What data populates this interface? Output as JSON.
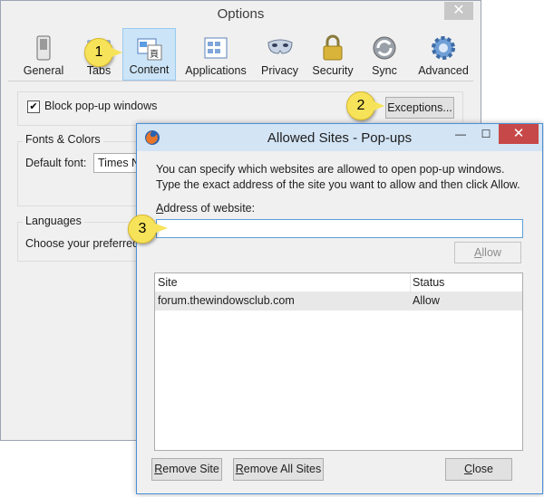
{
  "options_window": {
    "title": "Options",
    "close_glyph": "✕",
    "toolbar": [
      {
        "label": "General",
        "icon": "switch-icon"
      },
      {
        "label": "Tabs",
        "icon": "tabs-icon"
      },
      {
        "label": "Content",
        "icon": "content-icon",
        "selected": true
      },
      {
        "label": "Applications",
        "icon": "applications-icon"
      },
      {
        "label": "Privacy",
        "icon": "mask-icon"
      },
      {
        "label": "Security",
        "icon": "lock-icon"
      },
      {
        "label": "Sync",
        "icon": "sync-icon"
      },
      {
        "label": "Advanced",
        "icon": "gear-icon"
      }
    ],
    "block_popups_label": "Block pop-up windows",
    "block_popups_checked": true,
    "exceptions_label": "Exceptions...",
    "fonts_colors_group": "Fonts & Colors",
    "default_font_label": "Default font:",
    "default_font_value": "Times N",
    "languages_group": "Languages",
    "choose_preferred_label": "Choose your preferred"
  },
  "callouts": [
    "1",
    "2",
    "3"
  ],
  "dialog": {
    "title": "Allowed Sites - Pop-ups",
    "minimize_glyph": "—",
    "maximize_glyph": "☐",
    "close_glyph": "✕",
    "description": "You can specify which websites are allowed to open pop-up windows. Type the exact address of the site you want to allow and then click Allow.",
    "address_label": "Address of website:",
    "address_value": "",
    "allow_label": "Allow",
    "columns": [
      "Site",
      "Status"
    ],
    "rows": [
      {
        "site": "forum.thewindowsclub.com",
        "status": "Allow"
      }
    ],
    "remove_site_label": "Remove Site",
    "remove_all_label": "Remove All Sites",
    "close_label": "Close"
  },
  "colors": {
    "selected_tab_bg": "#cce4f7",
    "dialog_titlebar": "#d3e4f5",
    "close_button_red": "#c74848",
    "callout_yellow": "#f7e35a"
  }
}
